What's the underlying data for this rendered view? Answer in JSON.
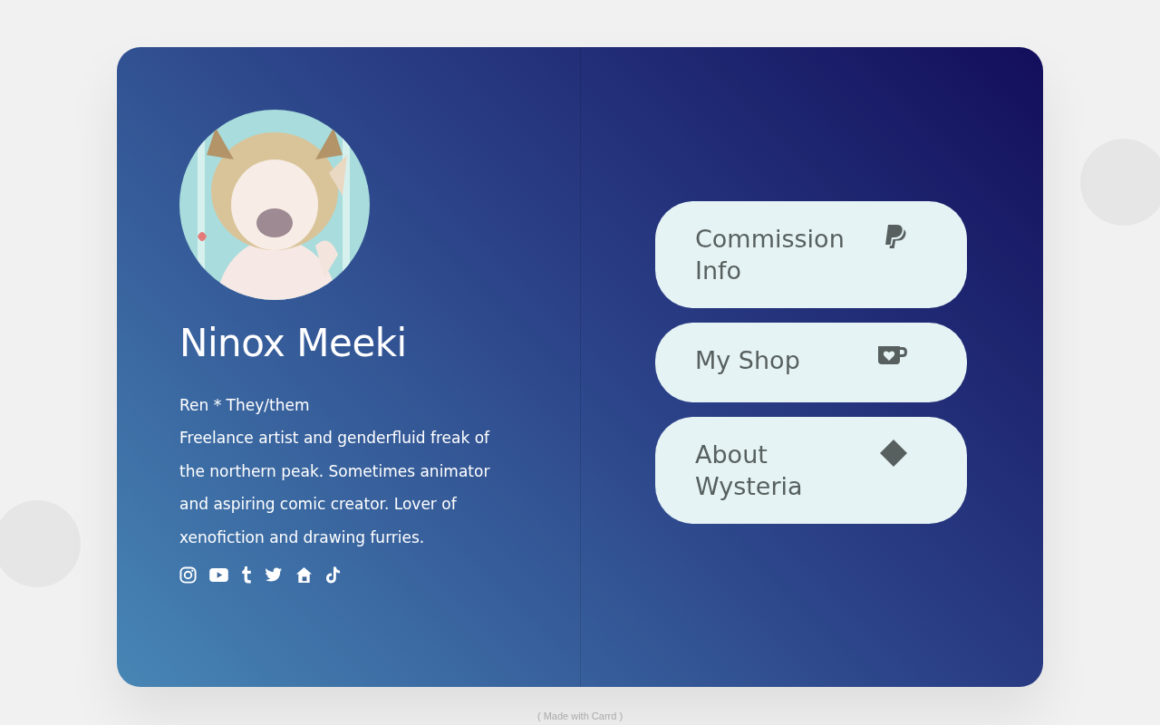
{
  "profile": {
    "name": "Ninox Meeki",
    "pronouns": "Ren * They/them",
    "bio": "Freelance artist and genderfluid freak of the northern peak. Sometimes animator and aspiring comic creator. Lover of xenofiction and drawing furries."
  },
  "links": [
    {
      "label": "Commission Info",
      "kind": "paypal"
    },
    {
      "label": "My Shop",
      "kind": "kofi"
    },
    {
      "label": "About Wysteria",
      "kind": "diamond"
    }
  ],
  "footer": "( Made with Carrd )"
}
